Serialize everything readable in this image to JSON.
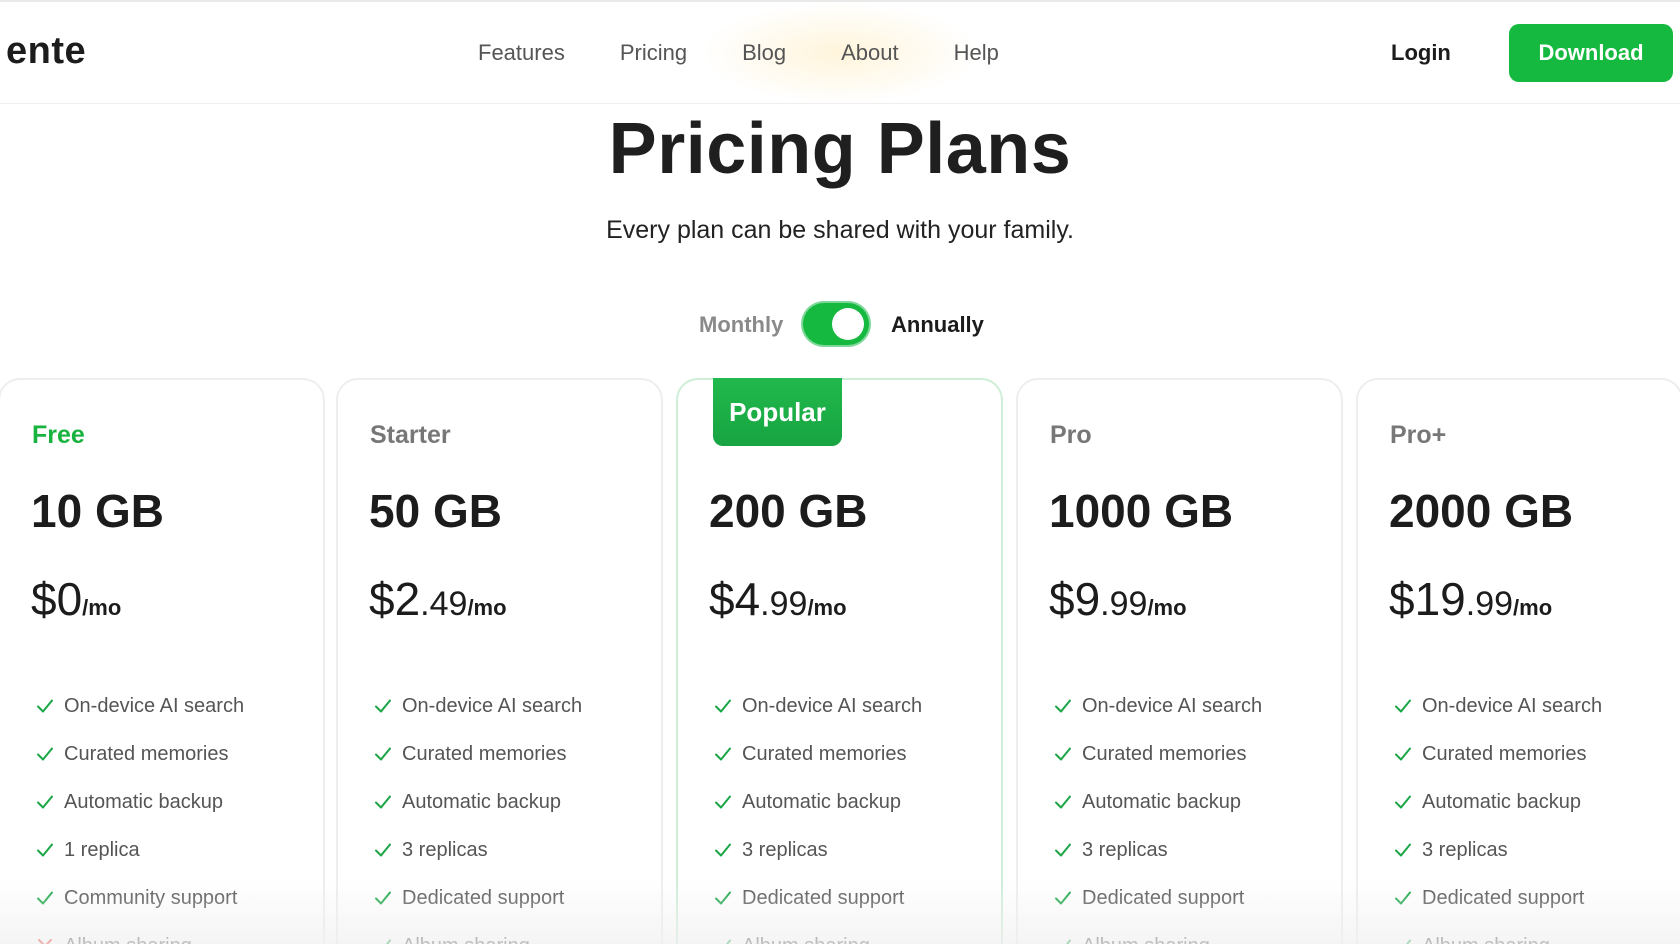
{
  "header": {
    "logo": "ente",
    "nav": [
      {
        "label": "Features"
      },
      {
        "label": "Pricing"
      },
      {
        "label": "Blog"
      },
      {
        "label": "About"
      },
      {
        "label": "Help"
      }
    ],
    "login_label": "Login",
    "download_label": "Download"
  },
  "hero": {
    "title": "Pricing Plans",
    "subtitle": "Every plan can be shared with your family."
  },
  "billing_toggle": {
    "monthly_label": "Monthly",
    "annually_label": "Annually",
    "selected": "Annually"
  },
  "colors": {
    "accent": "#16b93f",
    "text": "#1c1c1c",
    "muted": "#777777",
    "cross": "#e0312b"
  },
  "plans": [
    {
      "name": "Free",
      "storage": "10 GB",
      "price_dollars": "$0",
      "price_cents": "",
      "price_unit": "/mo",
      "features": [
        {
          "label": "On-device AI search",
          "icon": "check-icon"
        },
        {
          "label": "Curated memories",
          "icon": "check-icon"
        },
        {
          "label": "Automatic backup",
          "icon": "check-icon"
        },
        {
          "label": "1 replica",
          "icon": "check-icon"
        },
        {
          "label": "Community support",
          "icon": "check-icon"
        },
        {
          "label": "Album sharing",
          "icon": "cross-icon"
        }
      ]
    },
    {
      "name": "Starter",
      "storage": "50 GB",
      "price_dollars": "$2",
      "price_cents": ".49",
      "price_unit": "/mo",
      "features": [
        {
          "label": "On-device AI search",
          "icon": "check-icon"
        },
        {
          "label": "Curated memories",
          "icon": "check-icon"
        },
        {
          "label": "Automatic backup",
          "icon": "check-icon"
        },
        {
          "label": "3 replicas",
          "icon": "check-icon"
        },
        {
          "label": "Dedicated support",
          "icon": "check-icon"
        },
        {
          "label": "Album sharing",
          "icon": "check-icon"
        }
      ]
    },
    {
      "name": "",
      "badge": "Popular",
      "storage": "200 GB",
      "price_dollars": "$4",
      "price_cents": ".99",
      "price_unit": "/mo",
      "features": [
        {
          "label": "On-device AI search",
          "icon": "check-icon"
        },
        {
          "label": "Curated memories",
          "icon": "check-icon"
        },
        {
          "label": "Automatic backup",
          "icon": "check-icon"
        },
        {
          "label": "3 replicas",
          "icon": "check-icon"
        },
        {
          "label": "Dedicated support",
          "icon": "check-icon"
        },
        {
          "label": "Album sharing",
          "icon": "check-icon"
        }
      ]
    },
    {
      "name": "Pro",
      "storage": "1000 GB",
      "price_dollars": "$9",
      "price_cents": ".99",
      "price_unit": "/mo",
      "features": [
        {
          "label": "On-device AI search",
          "icon": "check-icon"
        },
        {
          "label": "Curated memories",
          "icon": "check-icon"
        },
        {
          "label": "Automatic backup",
          "icon": "check-icon"
        },
        {
          "label": "3 replicas",
          "icon": "check-icon"
        },
        {
          "label": "Dedicated support",
          "icon": "check-icon"
        },
        {
          "label": "Album sharing",
          "icon": "check-icon"
        }
      ]
    },
    {
      "name": "Pro+",
      "storage": "2000 GB",
      "price_dollars": "$19",
      "price_cents": ".99",
      "price_unit": "/mo",
      "features": [
        {
          "label": "On-device AI search",
          "icon": "check-icon"
        },
        {
          "label": "Curated memories",
          "icon": "check-icon"
        },
        {
          "label": "Automatic backup",
          "icon": "check-icon"
        },
        {
          "label": "3 replicas",
          "icon": "check-icon"
        },
        {
          "label": "Dedicated support",
          "icon": "check-icon"
        },
        {
          "label": "Album sharing",
          "icon": "check-icon"
        }
      ]
    }
  ]
}
